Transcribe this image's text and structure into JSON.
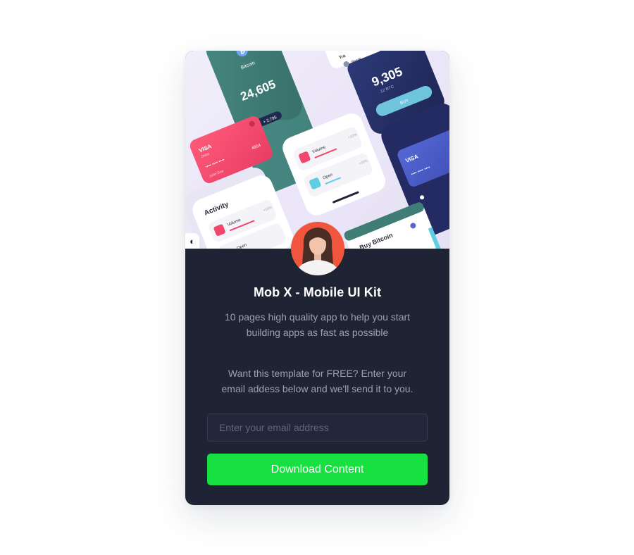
{
  "card": {
    "title": "Mob X - Mobile UI Kit",
    "subtitle": "10 pages high quality app to help you start building apps as fast as possible",
    "offer_text": "Want this template for FREE? Enter your email addess below and we'll send it to you.",
    "email_placeholder": "Enter your email address",
    "download_label": "Download Content"
  },
  "preview": {
    "bitcoin_label": "Bitcoin",
    "green_balance": "24,605",
    "green_change": "+ 2,795",
    "navy_amount": "9,305",
    "navy_caption": "12 BTC",
    "buy_label": "BUY",
    "trade_label": "Tra",
    "ripple_label": "Ripple",
    "card_brand": "VISA",
    "card_type": "Debit",
    "card_mask": "••••   ••••   ••••",
    "card_last": "4854",
    "card_holder": "John Doe",
    "activity_title": "Activity",
    "volume_label": "Volume",
    "open_label": "Open",
    "percent_1": "+10%",
    "percent_2": "+10%",
    "buy_bitcoin_label": "Buy Bitcoin"
  },
  "colors": {
    "accent_green": "#17e140",
    "card_bg": "#1f2434",
    "pink": "#f0476b",
    "teal": "#3c7a77",
    "navy": "#27306b"
  },
  "icons": {
    "theme_toggle": "◐"
  }
}
